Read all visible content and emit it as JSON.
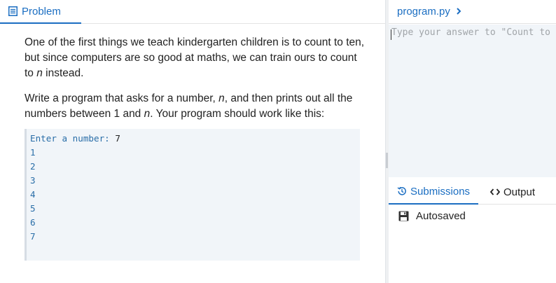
{
  "problem_tab": {
    "label": "Problem",
    "icon": "document-icon"
  },
  "problem": {
    "para1_before": "One of the first things we teach kindergarten children is to count to ten, but since computers are so good at maths, we can train ours to count to ",
    "para1_var": "n",
    "para1_after": " instead.",
    "para2_before": "Write a program that asks for a number, ",
    "para2_var1": "n",
    "para2_mid": ", and then prints out all the numbers between 1 and ",
    "para2_var2": "n",
    "para2_after": ". Your program should work like this:"
  },
  "example": {
    "prompt": "Enter a number: ",
    "input": "7",
    "output": [
      "1",
      "2",
      "3",
      "4",
      "5",
      "6",
      "7"
    ]
  },
  "file_tab": {
    "label": "program.py",
    "icon": "chevron-right-icon"
  },
  "editor": {
    "placeholder": "Type your answer to \"Count to n\" here"
  },
  "panel_tabs": {
    "submissions": {
      "label": "Submissions",
      "icon": "history-icon"
    },
    "output": {
      "label": "Output",
      "icon": "code-icon"
    }
  },
  "status": {
    "autosaved": "Autosaved",
    "icon": "save-icon"
  },
  "colors": {
    "accent": "#1b6ec2",
    "code_bg": "#f1f5f9",
    "code_text": "#2a6ea8"
  }
}
